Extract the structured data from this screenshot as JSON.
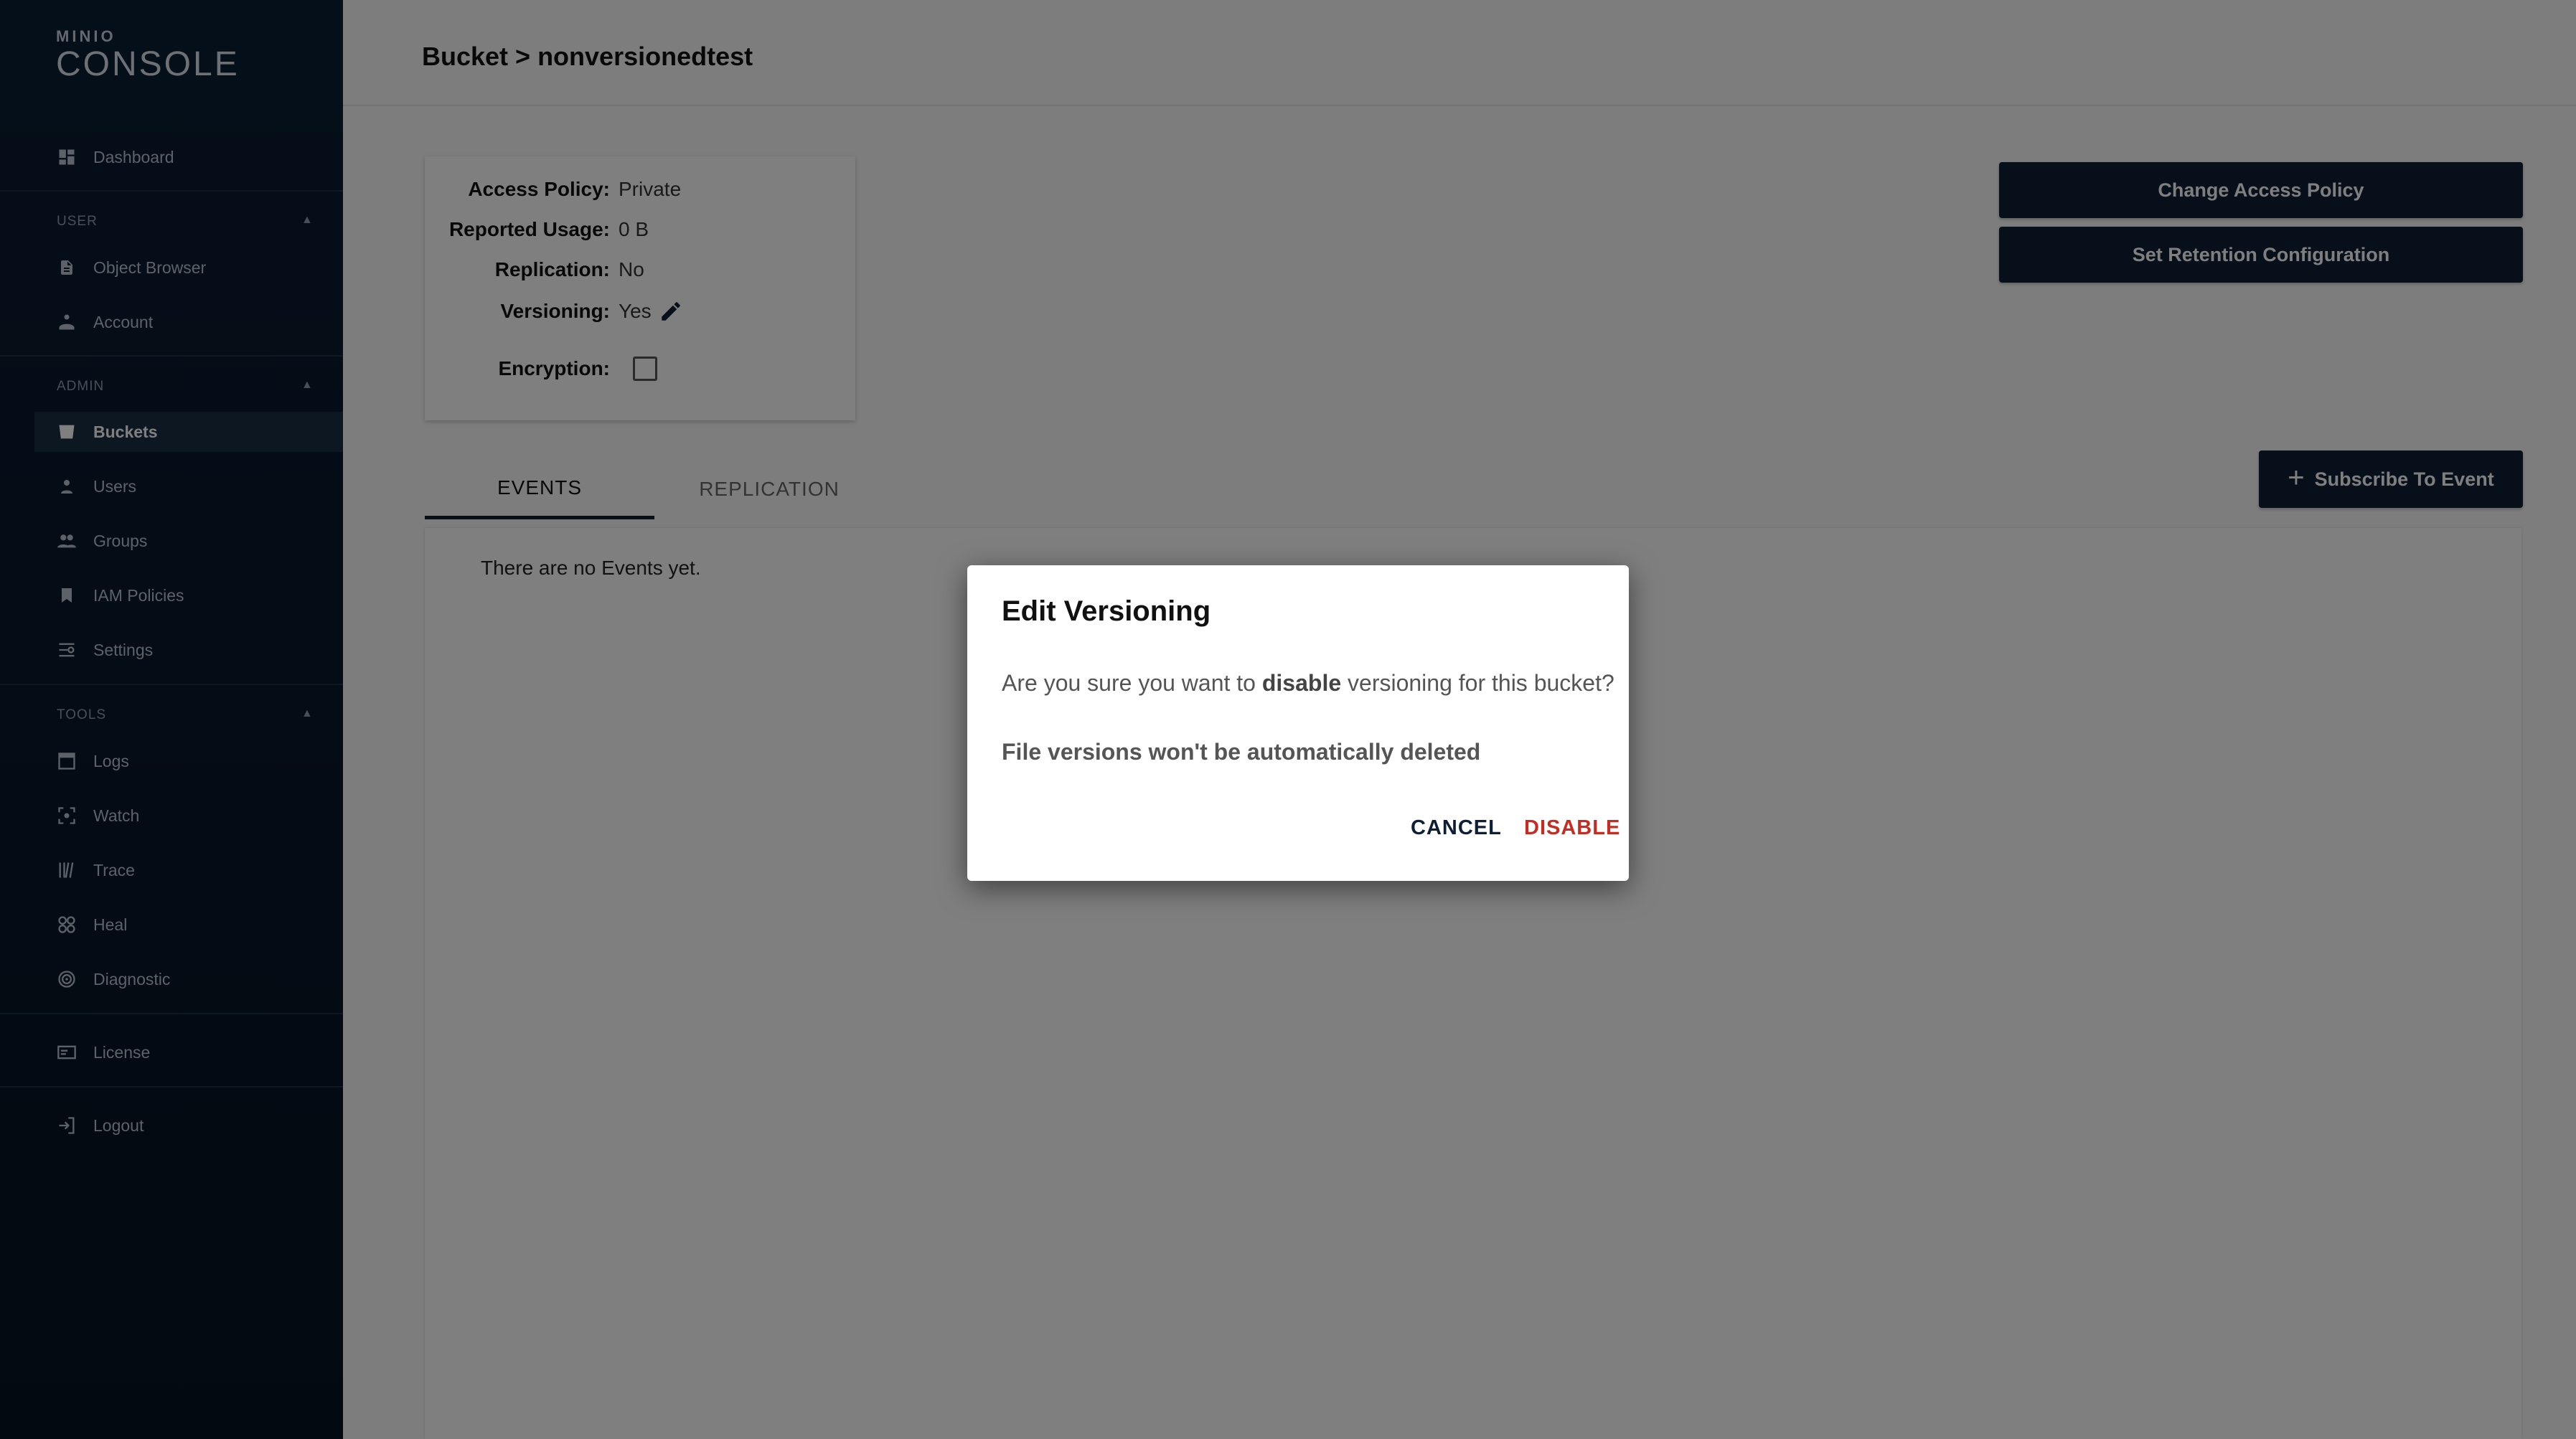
{
  "app": {
    "logo_small": "MINIO",
    "logo_big": "CONSOLE"
  },
  "sidebar": {
    "dashboard": "Dashboard",
    "sections": {
      "user": "USER",
      "admin": "ADMIN",
      "tools": "TOOLS"
    },
    "user_items": [
      "Object Browser",
      "Account"
    ],
    "admin_items": [
      "Buckets",
      "Users",
      "Groups",
      "IAM Policies",
      "Settings"
    ],
    "tools_items": [
      "Logs",
      "Watch",
      "Trace",
      "Heal",
      "Diagnostic"
    ],
    "license": "License",
    "logout": "Logout"
  },
  "header": {
    "title": "Bucket > nonversionedtest"
  },
  "bucket_info": {
    "access_policy_label": "Access Policy:",
    "access_policy_value": "Private",
    "reported_usage_label": "Reported Usage:",
    "reported_usage_value": "0 B",
    "replication_label": "Replication:",
    "replication_value": "No",
    "versioning_label": "Versioning:",
    "versioning_value": "Yes",
    "encryption_label": "Encryption:"
  },
  "actions": {
    "change_access_policy": "Change Access Policy",
    "set_retention": "Set Retention Configuration",
    "subscribe": "Subscribe To Event"
  },
  "tabs": {
    "events": "EVENTS",
    "replication": "REPLICATION"
  },
  "events": {
    "empty_message": "There are no Events yet."
  },
  "modal": {
    "title": "Edit Versioning",
    "text_before": "Are you sure you want to ",
    "text_bold": "disable",
    "text_after": " versioning for this bucket?",
    "note": "File versions won't be automatically deleted",
    "cancel": "CANCEL",
    "disable": "DISABLE"
  },
  "colors": {
    "primary": "#0e1f35",
    "danger": "#c72c20"
  }
}
